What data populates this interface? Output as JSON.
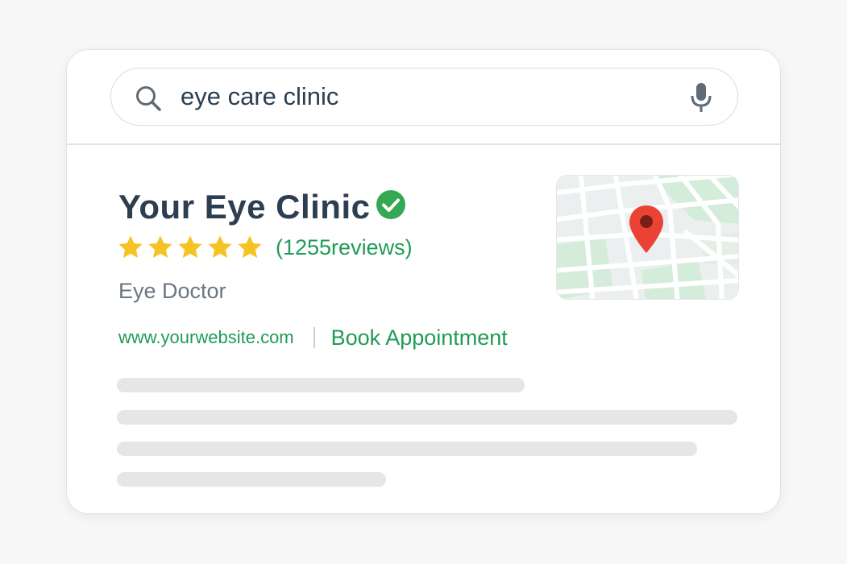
{
  "search": {
    "query": "eye care clinic",
    "search_icon": "search-icon",
    "mic_icon": "microphone-icon"
  },
  "business": {
    "name": "Your Eye Clinic",
    "verified_icon": "verified-check-icon",
    "rating_stars": 5,
    "reviews_text": "(1255reviews)",
    "category": "Eye Doctor",
    "website": "www.yourwebsite.com",
    "book_label": "Book Appointment"
  },
  "map": {
    "icon": "map-pin-icon"
  },
  "colors": {
    "accent_green": "#1f9b55",
    "title_dark": "#2c3e50",
    "star_yellow": "#f6c325",
    "pin_red": "#ea4335",
    "verified_green": "#34a853"
  }
}
